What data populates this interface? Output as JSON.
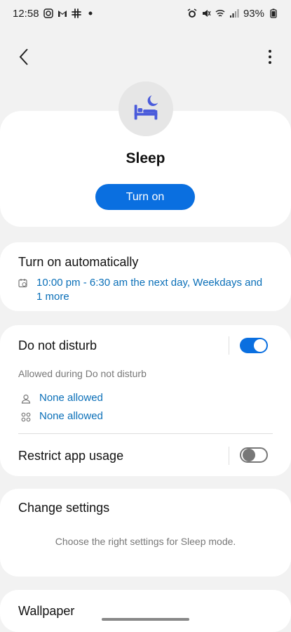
{
  "status_bar": {
    "time": "12:58",
    "battery": "93%"
  },
  "header": {
    "title": "Sleep",
    "turn_on_label": "Turn on"
  },
  "auto": {
    "title": "Turn on automatically",
    "schedule": "10:00 pm - 6:30 am the next day, Weekdays and 1 more"
  },
  "dnd": {
    "title": "Do not disturb",
    "enabled": true,
    "allowed_label": "Allowed during Do not disturb",
    "people_value": "None allowed",
    "apps_value": "None allowed",
    "restrict_title": "Restrict app usage",
    "restrict_enabled": false
  },
  "change": {
    "title": "Change settings",
    "description": "Choose the right settings for Sleep mode."
  },
  "wallpaper": {
    "title": "Wallpaper"
  },
  "colors": {
    "accent": "#0a6fe0",
    "link": "#0a6fb8",
    "icon": "#4a5bdb"
  }
}
